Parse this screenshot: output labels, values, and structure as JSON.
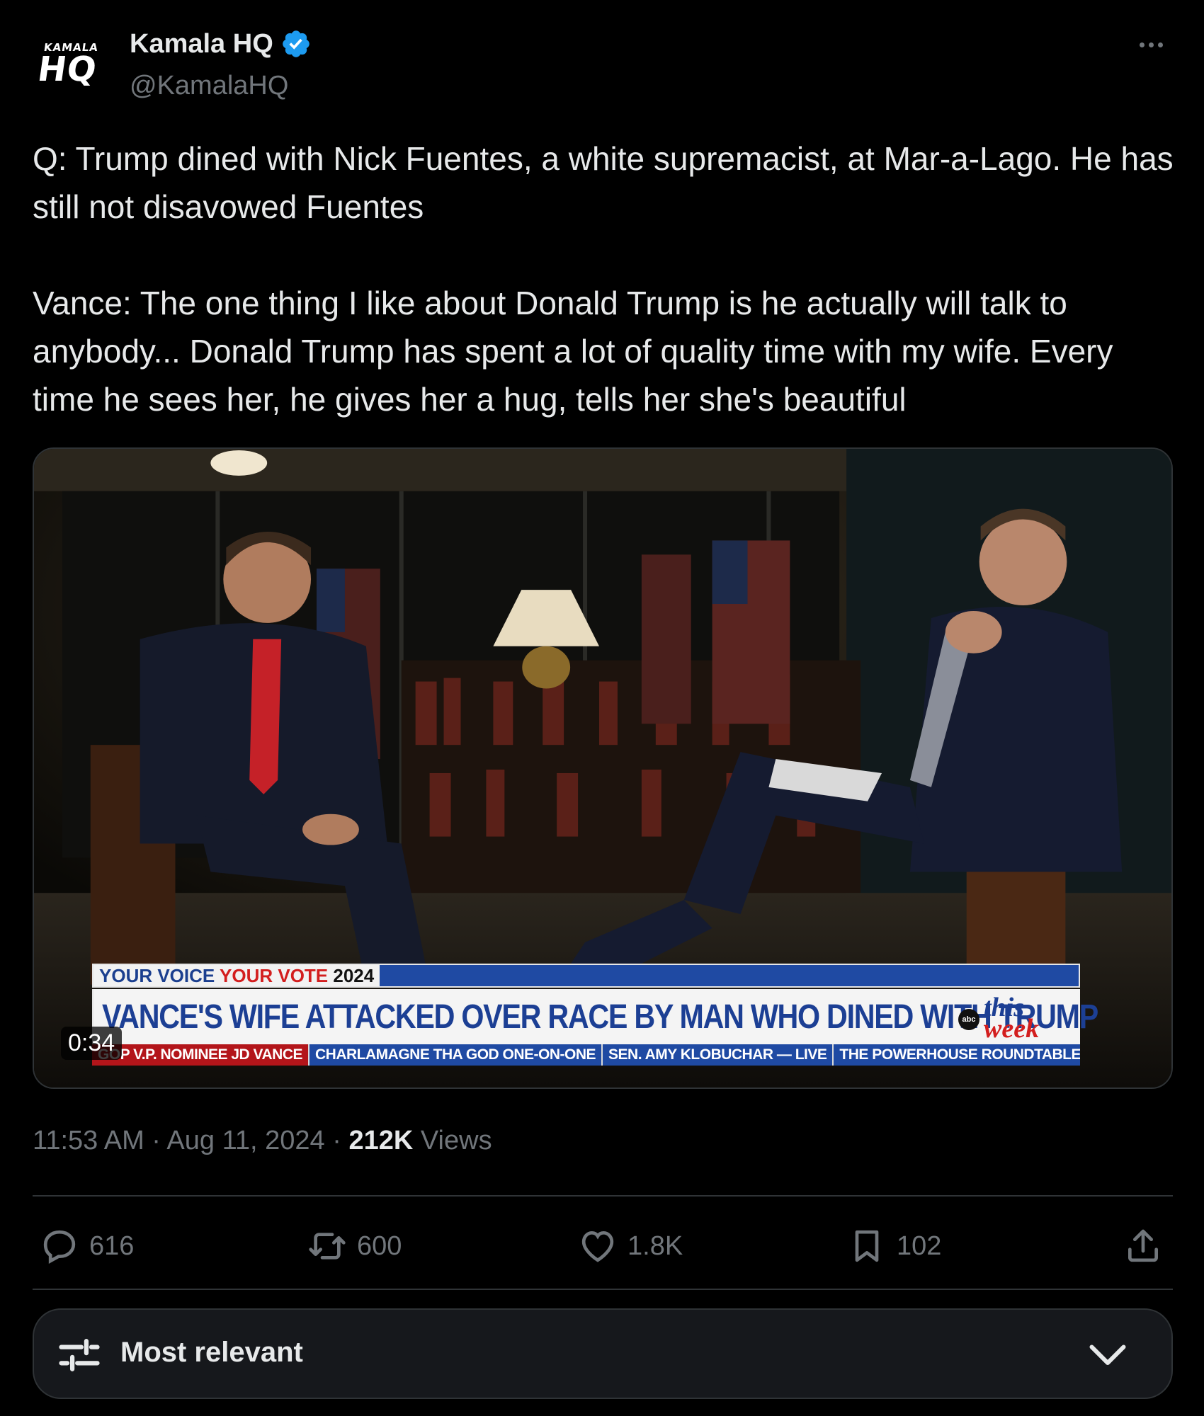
{
  "author": {
    "avatar_small": "KAMALA",
    "avatar_big": "HQ",
    "display_name": "Kamala HQ",
    "handle": "@KamalaHQ",
    "verified_icon": "verified-badge-icon"
  },
  "tweet": {
    "text": "Q: Trump dined with Nick Fuentes, a white supremacist, at Mar-a-Lago. He has still not disavowed Fuentes\n\nVance: The one thing I like about Donald Trump is he actually will talk to anybody... Donald Trump has spent a lot of quality time with my wife. Every time he sees her, he gives her a hug, tells her she's beautiful"
  },
  "video": {
    "duration": "0:34",
    "chyron_tag_a": "YOUR VOICE",
    "chyron_tag_b": "YOUR VOTE",
    "chyron_tag_c": "2024",
    "headline": "VANCE'S WIFE ATTACKED OVER RACE BY MAN WHO DINED WITH TRUMP",
    "logo_abc": "abc",
    "logo_this": "this",
    "logo_week": "week",
    "ticker": [
      "GOP V.P. NOMINEE JD VANCE",
      "CHARLAMAGNE THA GOD ONE-ON-ONE",
      "SEN. AMY KLOBUCHAR — LIVE",
      "THE POWERHOUSE ROUNDTABLE"
    ]
  },
  "meta": {
    "time": "11:53 AM",
    "sep1": "·",
    "date": "Aug 11, 2024",
    "sep2": "·",
    "views_count": "212K",
    "views_label": "Views"
  },
  "actions": {
    "replies": "616",
    "reposts": "600",
    "likes": "1.8K",
    "bookmarks": "102"
  },
  "sort": {
    "label": "Most relevant"
  },
  "colors": {
    "background": "#000000",
    "text": "#e7e9ea",
    "muted": "#71767b",
    "verified": "#1d9bf0",
    "border": "#2f3336"
  }
}
